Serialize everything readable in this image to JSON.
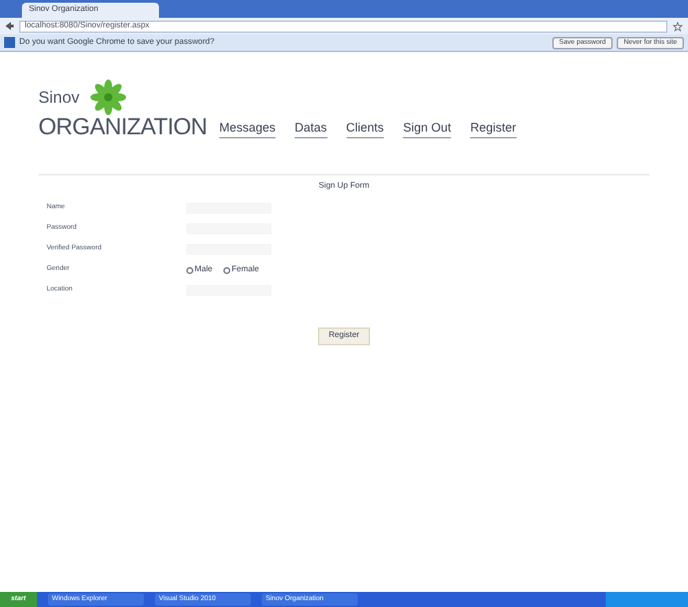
{
  "browser": {
    "tab_title": "Sinov Organization",
    "address": "localhost:8080/Sinov/register.aspx",
    "infobar": {
      "message": "Do you want Google Chrome to save your password?",
      "buttons": [
        "Save password",
        "Never for this site"
      ]
    }
  },
  "site": {
    "logo_top": "Sinov",
    "logo_bottom": "ORGANIZATION",
    "nav": [
      "Messages",
      "Datas",
      "Clients",
      "Sign Out",
      "Register"
    ]
  },
  "form": {
    "title": "Sign Up Form",
    "fields": [
      {
        "kind": "text",
        "label": "Name"
      },
      {
        "kind": "password",
        "label": "Password"
      },
      {
        "kind": "password",
        "label": "Verified Password"
      },
      {
        "kind": "radio",
        "label": "Gender",
        "options": [
          {
            "label": "Male",
            "selected": false
          },
          {
            "label": "Female",
            "selected": false
          }
        ]
      },
      {
        "kind": "text",
        "label": "Location"
      }
    ],
    "submit": "Register"
  },
  "taskbar": {
    "start": "start",
    "items": [
      "Windows Explorer",
      "Visual Studio 2010",
      "Sinov Organization"
    ]
  }
}
